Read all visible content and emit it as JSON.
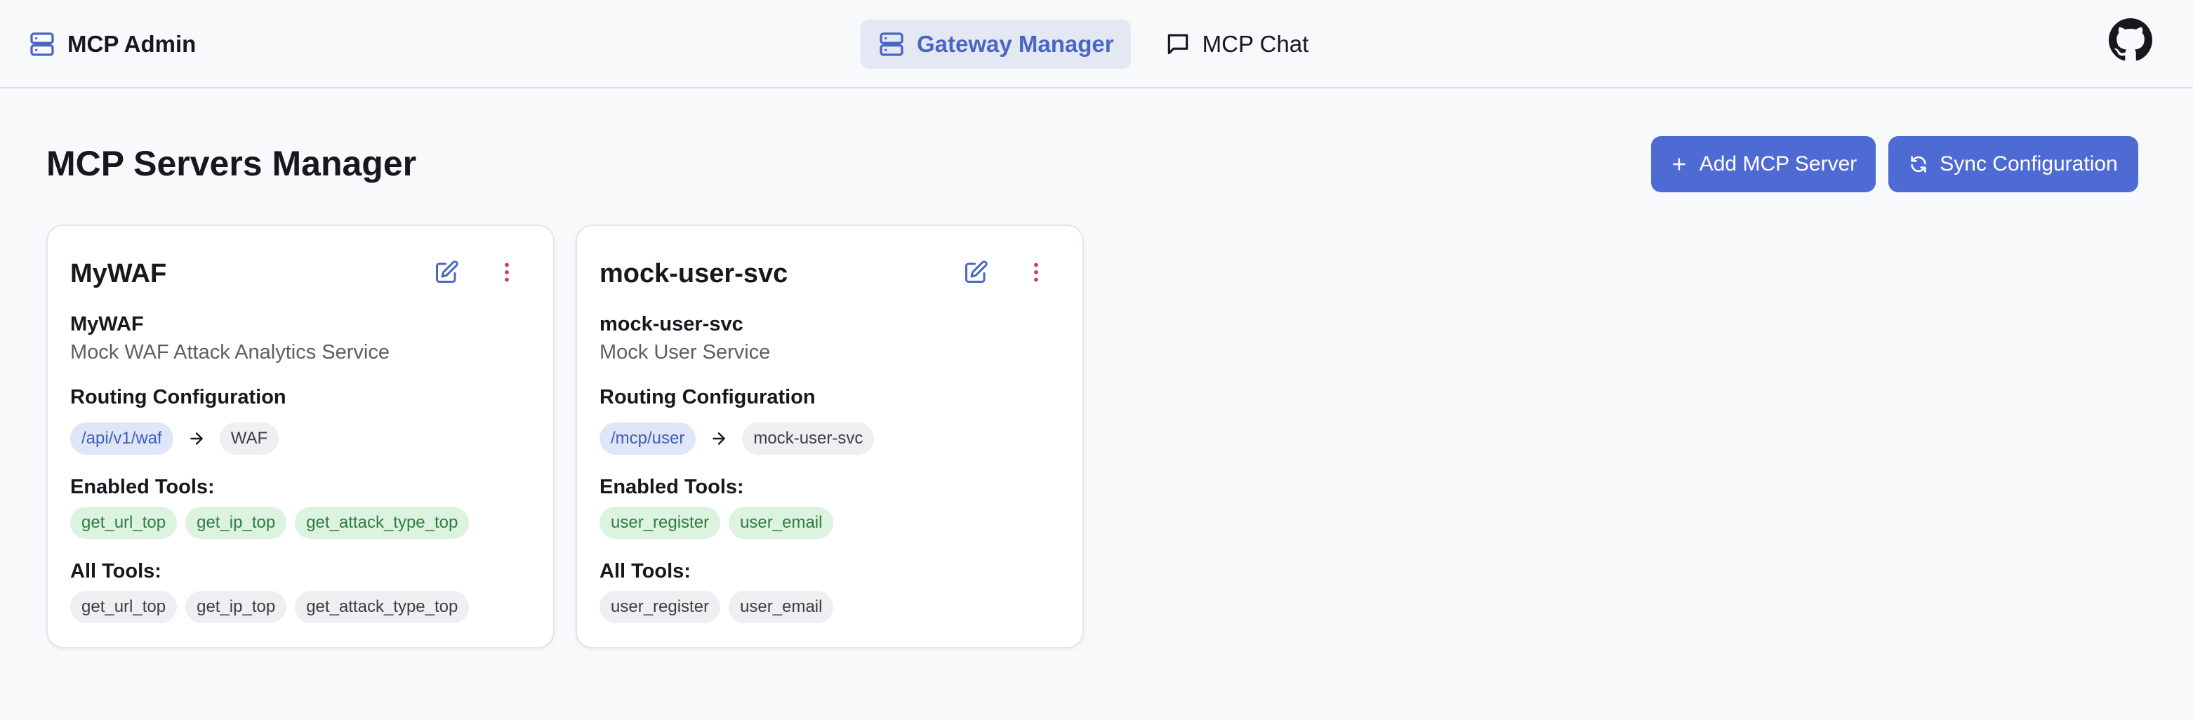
{
  "app": {
    "title": "MCP Admin",
    "brand_icon": "server-icon"
  },
  "nav": {
    "tabs": [
      {
        "label": "Gateway Manager",
        "icon": "server-icon",
        "active": true
      },
      {
        "label": "MCP Chat",
        "icon": "chat-bubble-icon",
        "active": false
      }
    ],
    "github_icon": "github-icon"
  },
  "page": {
    "title": "MCP Servers Manager",
    "add_button_label": "Add MCP Server",
    "sync_button_label": "Sync Configuration"
  },
  "colors": {
    "accent": "#4e6bd3",
    "active_tab_bg": "#e4e8f3",
    "active_tab_text": "#4a66c4",
    "danger_icon": "#d6336c",
    "enabled_chip_bg": "#dbf3df",
    "enabled_chip_text": "#2e7d42",
    "route_chip_bg": "#dfe6f7",
    "route_chip_text": "#3f5fb8"
  },
  "labels": {
    "routing": "Routing Configuration",
    "enabled_tools": "Enabled Tools:",
    "all_tools": "All Tools:"
  },
  "servers": [
    {
      "card_title": "MyWAF",
      "name": "MyWAF",
      "description": "Mock WAF Attack Analytics Service",
      "route_path": "/api/v1/waf",
      "route_target": "WAF",
      "enabled_tools": [
        "get_url_top",
        "get_ip_top",
        "get_attack_type_top"
      ],
      "all_tools": [
        "get_url_top",
        "get_ip_top",
        "get_attack_type_top"
      ]
    },
    {
      "card_title": "mock-user-svc",
      "name": "mock-user-svc",
      "description": "Mock User Service",
      "route_path": "/mcp/user",
      "route_target": "mock-user-svc",
      "enabled_tools": [
        "user_register",
        "user_email"
      ],
      "all_tools": [
        "user_register",
        "user_email"
      ]
    }
  ]
}
